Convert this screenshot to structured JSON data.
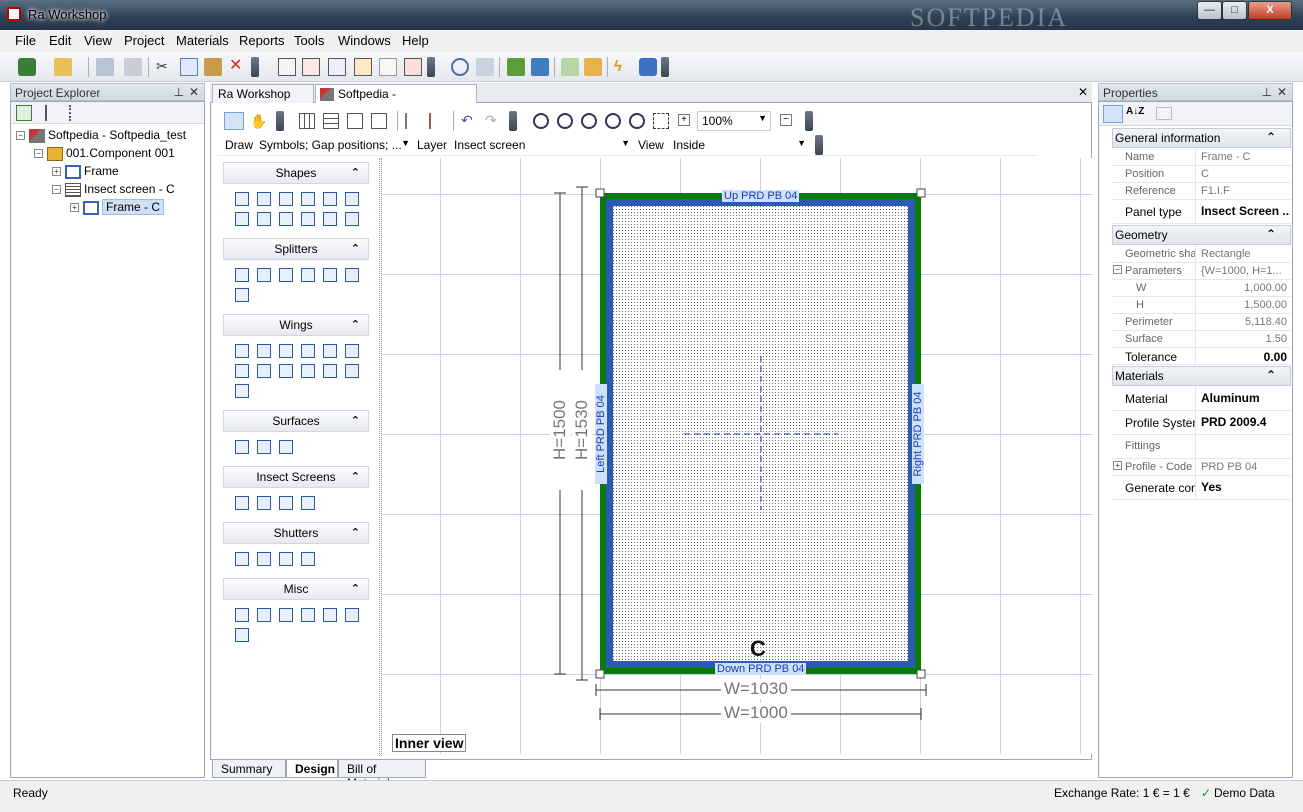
{
  "app": {
    "title": "Ra Workshop",
    "watermark": "SOFTPEDIA"
  },
  "window_buttons": {
    "minimize": "—",
    "maximize": "□",
    "close": "X"
  },
  "menu": [
    "File",
    "Edit",
    "View",
    "Project",
    "Materials",
    "Reports",
    "Tools",
    "Windows",
    "Help"
  ],
  "project_explorer": {
    "title": "Project Explorer",
    "pin": "⊥",
    "close": "✕",
    "tree": [
      {
        "label": "Softpedia - Softpedia_test",
        "level": 0,
        "expander": "−"
      },
      {
        "label": "001.Component 001",
        "level": 1,
        "expander": "−"
      },
      {
        "label": "Frame",
        "level": 2,
        "expander": "+"
      },
      {
        "label": "Insect screen - C",
        "level": 2,
        "expander": "−"
      },
      {
        "label": "Frame - C",
        "level": 3,
        "expander": "+",
        "selected": true
      }
    ]
  },
  "doc_tabs": [
    {
      "label": "Ra Workshop News",
      "active": false
    },
    {
      "label": "Softpedia - Softpedia_test*",
      "active": true
    }
  ],
  "doc_close": "✕",
  "design_toolbar": {
    "zoom": "100%"
  },
  "draw_bar": {
    "draw_label": "Draw",
    "draw_value": "Symbols; Gap positions; ...",
    "layer_label": "Layer",
    "layer_value": "Insect screen",
    "view_label": "View",
    "view_value": "Inside"
  },
  "palette": [
    {
      "title": "Shapes",
      "count": 12
    },
    {
      "title": "Splitters",
      "count": 7
    },
    {
      "title": "Wings",
      "count": 13
    },
    {
      "title": "Surfaces",
      "count": 3
    },
    {
      "title": "Insect Screens",
      "count": 4
    },
    {
      "title": "Shutters",
      "count": 4
    },
    {
      "title": "Misc",
      "count": 7
    }
  ],
  "palette_chevron": "⌃",
  "drawing": {
    "top_label": "Up PRD PB 04",
    "bottom_label": "Down PRD PB 04",
    "left_label": "Left PRD PB 04",
    "right_label": "Right PRD PB 04",
    "center_label": "C",
    "dim_h_inner": "H=1500",
    "dim_h_outer": "H=1530",
    "dim_w_outer": "W=1030",
    "dim_w_inner": "W=1000",
    "view_tag": "Inner view",
    "frame_color": "#0a7a0a",
    "inner_color": "#2c5bb5"
  },
  "bottom_tabs": [
    "Summary",
    "Design",
    "Bill of Material"
  ],
  "properties": {
    "title": "Properties",
    "sort_label": "A↓Z",
    "sections": {
      "general": "General information",
      "geometry": "Geometry",
      "materials": "Materials"
    },
    "general": [
      {
        "k": "Name",
        "v": "Frame - C"
      },
      {
        "k": "Position",
        "v": "C"
      },
      {
        "k": "Reference",
        "v": "F1.I.F"
      },
      {
        "k": "Panel type",
        "v": "Insect Screen ..."
      }
    ],
    "geometry": [
      {
        "k": "Geometric sha",
        "v": "Rectangle"
      },
      {
        "k": "Parameters",
        "v": "{W=1000, H=1..."
      },
      {
        "k": "W",
        "v": "1,000.00"
      },
      {
        "k": "H",
        "v": "1,500.00"
      },
      {
        "k": "Perimeter",
        "v": "5,118.40"
      },
      {
        "k": "Surface",
        "v": "1.50"
      },
      {
        "k": "Tolerance",
        "v": "0.00"
      }
    ],
    "materials": [
      {
        "k": "Material",
        "v": "Aluminum"
      },
      {
        "k": "Profile System",
        "v": "PRD 2009.4"
      },
      {
        "k": "Fittings",
        "v": ""
      },
      {
        "k": "Profile - Code",
        "v": "PRD PB 04"
      },
      {
        "k": "Generate con",
        "v": "Yes"
      }
    ]
  },
  "status": {
    "left": "Ready",
    "exchange": "Exchange Rate: 1 € = 1 €",
    "demo": "Demo Data",
    "check": "✓"
  }
}
